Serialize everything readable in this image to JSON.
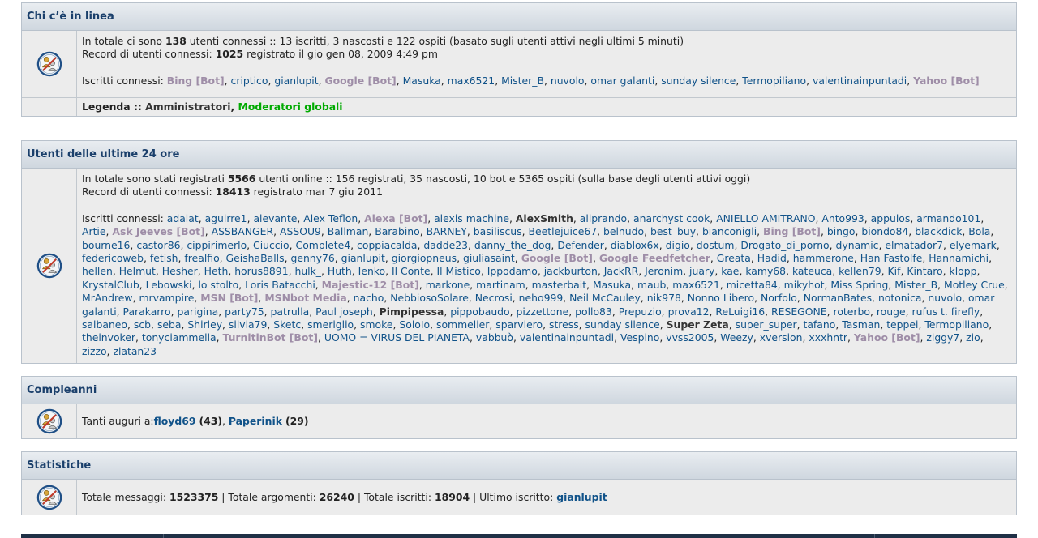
{
  "online": {
    "title": "Chi c’è in linea",
    "line1_pre": "In totale ci sono ",
    "line1_total": "138",
    "line1_post": " utenti connessi :: 13 iscritti, 3 nascosti e 122 ospiti (basato sugli utenti attivi negli ultimi 5 minuti)",
    "record_pre": "Record di utenti connessi: ",
    "record_count": "1025",
    "record_post": " registrato il gio gen 08, 2009 4:49 pm",
    "users_label": "Iscritti connessi: ",
    "users": [
      {
        "name": "Bing [Bot]",
        "type": "bot"
      },
      {
        "name": "criptico",
        "type": "user"
      },
      {
        "name": "gianlupit",
        "type": "user"
      },
      {
        "name": "Google [Bot]",
        "type": "bot"
      },
      {
        "name": "Masuka",
        "type": "user"
      },
      {
        "name": "max6521",
        "type": "user"
      },
      {
        "name": "Mister_B",
        "type": "user"
      },
      {
        "name": "nuvolo",
        "type": "user"
      },
      {
        "name": "omar galanti",
        "type": "user"
      },
      {
        "name": "sunday silence",
        "type": "user"
      },
      {
        "name": "Termopiliano",
        "type": "user"
      },
      {
        "name": "valentinainpuntadi",
        "type": "user"
      },
      {
        "name": "Yahoo [Bot]",
        "type": "bot"
      }
    ],
    "legend_label": "Legenda :: ",
    "legend_admin": "Amministratori",
    "legend_sep": ", ",
    "legend_mod": "Moderatori globali"
  },
  "last24": {
    "title": "Utenti delle ultime 24 ore",
    "line1_pre": "In totale sono stati registrati ",
    "line1_total": "5566",
    "line1_post": " utenti online :: 156 registrati, 35 nascosti, 10 bot e 5365 ospiti (sulla base degli utenti attivi oggi)",
    "record_pre": "Record di utenti connessi: ",
    "record_count": "18413",
    "record_post": " registrato mar 7 giu 2011",
    "users_label": "Iscritti connessi: ",
    "users": [
      {
        "name": "adalat",
        "type": "user"
      },
      {
        "name": "aguirre1",
        "type": "user"
      },
      {
        "name": "alevante",
        "type": "user"
      },
      {
        "name": "Alex Teflon",
        "type": "user"
      },
      {
        "name": "Alexa [Bot]",
        "type": "bot"
      },
      {
        "name": "alexis machine",
        "type": "user"
      },
      {
        "name": "AlexSmith",
        "type": "admin"
      },
      {
        "name": "aliprando",
        "type": "user"
      },
      {
        "name": "anarchyst cook",
        "type": "user"
      },
      {
        "name": "ANIELLO AMITRANO",
        "type": "user"
      },
      {
        "name": "Anto993",
        "type": "user"
      },
      {
        "name": "appulos",
        "type": "user"
      },
      {
        "name": "armando101",
        "type": "user"
      },
      {
        "name": "Artie",
        "type": "user"
      },
      {
        "name": "Ask Jeeves [Bot]",
        "type": "bot"
      },
      {
        "name": "ASSBANGER",
        "type": "user"
      },
      {
        "name": "ASSOU9",
        "type": "user"
      },
      {
        "name": "Ballman",
        "type": "user"
      },
      {
        "name": "Barabino",
        "type": "user"
      },
      {
        "name": "BARNEY",
        "type": "user"
      },
      {
        "name": "basiliscus",
        "type": "user"
      },
      {
        "name": "Beetlejuice67",
        "type": "user"
      },
      {
        "name": "belnudo",
        "type": "user"
      },
      {
        "name": "best_buy",
        "type": "user"
      },
      {
        "name": "bianconigli",
        "type": "user"
      },
      {
        "name": "Bing [Bot]",
        "type": "bot"
      },
      {
        "name": "bingo",
        "type": "user"
      },
      {
        "name": "biondo84",
        "type": "user"
      },
      {
        "name": "blackdick",
        "type": "user"
      },
      {
        "name": "Bola",
        "type": "user"
      },
      {
        "name": "bourne16",
        "type": "user"
      },
      {
        "name": "castor86",
        "type": "user"
      },
      {
        "name": "cippirimerlo",
        "type": "user"
      },
      {
        "name": "Ciuccio",
        "type": "user"
      },
      {
        "name": "Complete4",
        "type": "user"
      },
      {
        "name": "coppiacalda",
        "type": "user"
      },
      {
        "name": "dadde23",
        "type": "user"
      },
      {
        "name": "danny_the_dog",
        "type": "user"
      },
      {
        "name": "Defender",
        "type": "user"
      },
      {
        "name": "diablox6x",
        "type": "user"
      },
      {
        "name": "digio",
        "type": "user"
      },
      {
        "name": "dostum",
        "type": "user"
      },
      {
        "name": "Drogato_di_porno",
        "type": "user"
      },
      {
        "name": "dynamic",
        "type": "user"
      },
      {
        "name": "elmatador7",
        "type": "user"
      },
      {
        "name": "elyemark",
        "type": "user"
      },
      {
        "name": "federicoweb",
        "type": "user"
      },
      {
        "name": "fetish",
        "type": "user"
      },
      {
        "name": "frealfio",
        "type": "user"
      },
      {
        "name": "GeishaBalls",
        "type": "user"
      },
      {
        "name": "genny76",
        "type": "user"
      },
      {
        "name": "gianlupit",
        "type": "user"
      },
      {
        "name": "giorgiopneus",
        "type": "user"
      },
      {
        "name": "giuliasaint",
        "type": "user"
      },
      {
        "name": "Google [Bot]",
        "type": "bot"
      },
      {
        "name": "Google Feedfetcher",
        "type": "bot"
      },
      {
        "name": "Greata",
        "type": "user"
      },
      {
        "name": "Hadid",
        "type": "user"
      },
      {
        "name": "hammerone",
        "type": "user"
      },
      {
        "name": "Han Fastolfe",
        "type": "user"
      },
      {
        "name": "Hannamichi",
        "type": "user"
      },
      {
        "name": "hellen",
        "type": "user"
      },
      {
        "name": "Helmut",
        "type": "user"
      },
      {
        "name": "Hesher",
        "type": "user"
      },
      {
        "name": "Heth",
        "type": "user"
      },
      {
        "name": "horus8891",
        "type": "user"
      },
      {
        "name": "hulk_",
        "type": "user"
      },
      {
        "name": "Huth",
        "type": "user"
      },
      {
        "name": "Ienko",
        "type": "user"
      },
      {
        "name": "Il Conte",
        "type": "user"
      },
      {
        "name": "Il Mistico",
        "type": "user"
      },
      {
        "name": "Ippodamo",
        "type": "user"
      },
      {
        "name": "jackburton",
        "type": "user"
      },
      {
        "name": "JackRR",
        "type": "user"
      },
      {
        "name": "Jeronim",
        "type": "user"
      },
      {
        "name": "juary",
        "type": "user"
      },
      {
        "name": "kae",
        "type": "user"
      },
      {
        "name": "kamy68",
        "type": "user"
      },
      {
        "name": "kateuca",
        "type": "user"
      },
      {
        "name": "kellen79",
        "type": "user"
      },
      {
        "name": "Kif",
        "type": "user"
      },
      {
        "name": "Kintaro",
        "type": "user"
      },
      {
        "name": "klopp",
        "type": "user"
      },
      {
        "name": "KrystalClub",
        "type": "user"
      },
      {
        "name": "Lebowski",
        "type": "user"
      },
      {
        "name": "lo stolto",
        "type": "user"
      },
      {
        "name": "Loris Batacchi",
        "type": "user"
      },
      {
        "name": "Majestic-12 [Bot]",
        "type": "bot"
      },
      {
        "name": "markone",
        "type": "user"
      },
      {
        "name": "martinam",
        "type": "user"
      },
      {
        "name": "masterbait",
        "type": "user"
      },
      {
        "name": "Masuka",
        "type": "user"
      },
      {
        "name": "maub",
        "type": "user"
      },
      {
        "name": "max6521",
        "type": "user"
      },
      {
        "name": "micetta84",
        "type": "user"
      },
      {
        "name": "mikyhot",
        "type": "user"
      },
      {
        "name": "Miss Spring",
        "type": "user"
      },
      {
        "name": "Mister_B",
        "type": "user"
      },
      {
        "name": "Motley Crue",
        "type": "user"
      },
      {
        "name": "MrAndrew",
        "type": "user"
      },
      {
        "name": "mrvampire",
        "type": "user"
      },
      {
        "name": "MSN [Bot]",
        "type": "bot"
      },
      {
        "name": "MSNbot Media",
        "type": "bot"
      },
      {
        "name": "nacho",
        "type": "user"
      },
      {
        "name": "NebbiosoSolare",
        "type": "user"
      },
      {
        "name": "Necrosi",
        "type": "user"
      },
      {
        "name": "neho999",
        "type": "user"
      },
      {
        "name": "Neil McCauley",
        "type": "user"
      },
      {
        "name": "nik978",
        "type": "user"
      },
      {
        "name": "Nonno Libero",
        "type": "user"
      },
      {
        "name": "Norfolo",
        "type": "user"
      },
      {
        "name": "NormanBates",
        "type": "user"
      },
      {
        "name": "notonica",
        "type": "user"
      },
      {
        "name": "nuvolo",
        "type": "user"
      },
      {
        "name": "omar galanti",
        "type": "user"
      },
      {
        "name": "Parakarro",
        "type": "user"
      },
      {
        "name": "parigina",
        "type": "user"
      },
      {
        "name": "party75",
        "type": "user"
      },
      {
        "name": "patrulla",
        "type": "user"
      },
      {
        "name": "Paul joseph",
        "type": "user"
      },
      {
        "name": "Pimpipessa",
        "type": "admin"
      },
      {
        "name": "pippobaudo",
        "type": "user"
      },
      {
        "name": "pizzettone",
        "type": "user"
      },
      {
        "name": "pollo83",
        "type": "user"
      },
      {
        "name": "Prepuzio",
        "type": "user"
      },
      {
        "name": "prova12",
        "type": "user"
      },
      {
        "name": "ReLuigi16",
        "type": "user"
      },
      {
        "name": "RESEGONE",
        "type": "user"
      },
      {
        "name": "roterbo",
        "type": "user"
      },
      {
        "name": "rouge",
        "type": "user"
      },
      {
        "name": "rufus t. firefly",
        "type": "user"
      },
      {
        "name": "salbaneo",
        "type": "user"
      },
      {
        "name": "scb",
        "type": "user"
      },
      {
        "name": "seba",
        "type": "user"
      },
      {
        "name": "Shirley",
        "type": "user"
      },
      {
        "name": "silvia79",
        "type": "user"
      },
      {
        "name": "Sketc",
        "type": "user"
      },
      {
        "name": "smeriglio",
        "type": "user"
      },
      {
        "name": "smoke",
        "type": "user"
      },
      {
        "name": "SoloIo",
        "type": "user"
      },
      {
        "name": "sommelier",
        "type": "user"
      },
      {
        "name": "sparviero",
        "type": "user"
      },
      {
        "name": "stress",
        "type": "user"
      },
      {
        "name": "sunday silence",
        "type": "user"
      },
      {
        "name": "Super Zeta",
        "type": "admin"
      },
      {
        "name": "super_super",
        "type": "user"
      },
      {
        "name": "tafano",
        "type": "user"
      },
      {
        "name": "Tasman",
        "type": "user"
      },
      {
        "name": "teppei",
        "type": "user"
      },
      {
        "name": "Termopiliano",
        "type": "user"
      },
      {
        "name": "theinvoker",
        "type": "user"
      },
      {
        "name": "tonyciammella",
        "type": "user"
      },
      {
        "name": "TurnitinBot [Bot]",
        "type": "bot"
      },
      {
        "name": "UOMO = VIRUS DEL PIANETA",
        "type": "user"
      },
      {
        "name": "vabbuò",
        "type": "user"
      },
      {
        "name": "valentinainpuntadi",
        "type": "user"
      },
      {
        "name": "Vespino",
        "type": "user"
      },
      {
        "name": "vvss2005",
        "type": "user"
      },
      {
        "name": "Weezy",
        "type": "user"
      },
      {
        "name": "xversion",
        "type": "user"
      },
      {
        "name": "xxxhntr",
        "type": "user"
      },
      {
        "name": "Yahoo [Bot]",
        "type": "bot"
      },
      {
        "name": "ziggy7",
        "type": "user"
      },
      {
        "name": "zio",
        "type": "user"
      },
      {
        "name": "zizzo",
        "type": "user"
      },
      {
        "name": "zlatan23",
        "type": "user"
      }
    ]
  },
  "birthdays": {
    "title": "Compleanni",
    "label": "Tanti auguri a: ",
    "people": [
      {
        "name": "floyd69",
        "age": "(43)"
      },
      {
        "name": "Paperinik",
        "age": "(29)"
      }
    ]
  },
  "stats": {
    "title": "Statistiche",
    "posts_label": "Totale messaggi: ",
    "posts": "1523375",
    "sep": " | ",
    "topics_label": "Totale argomenti: ",
    "topics": "26240",
    "members_label": "Totale iscritti: ",
    "members": "18904",
    "newest_label": "Ultimo iscritto: ",
    "newest": "gianlupit"
  },
  "colors": {
    "link": "#105289",
    "bot": "#9e8da7",
    "moderator": "#00aa00",
    "header_text": "#1a3f6b"
  },
  "icon_name": "whos-online-icon"
}
